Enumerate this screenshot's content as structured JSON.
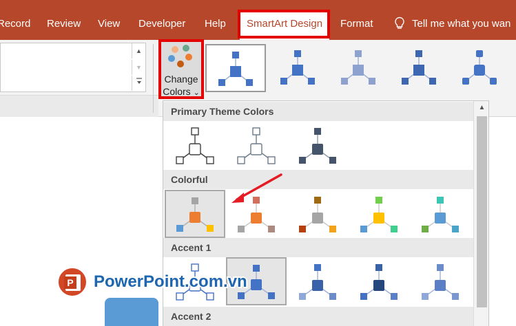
{
  "tabs": [
    {
      "label": "Record"
    },
    {
      "label": "Review"
    },
    {
      "label": "View"
    },
    {
      "label": "Developer"
    },
    {
      "label": "Help"
    },
    {
      "label": "SmartArt Design",
      "selected": true
    },
    {
      "label": "Format"
    }
  ],
  "tell_me": {
    "text": "Tell me what you wan",
    "icon": "lightbulb-icon"
  },
  "change_colors": {
    "line1": "Change",
    "line2": "Colors",
    "chevron": "⌄"
  },
  "gallery": {
    "sections": [
      {
        "title": "Primary Theme Colors"
      },
      {
        "title": "Colorful"
      },
      {
        "title": "Accent 1"
      },
      {
        "title": "Accent 2"
      }
    ]
  },
  "watermark": {
    "text": "PowerPoint.com.vn",
    "logo_letter": "P"
  },
  "colors": {
    "ribbon_tab_bg": "#b7472a",
    "highlight": "#e50000",
    "accent_blue": "#4472c4",
    "orange": "#ed7d31",
    "gray": "#a5a5a5",
    "gold": "#ffc000",
    "blue": "#5b9bd5",
    "green": "#70ad47"
  }
}
